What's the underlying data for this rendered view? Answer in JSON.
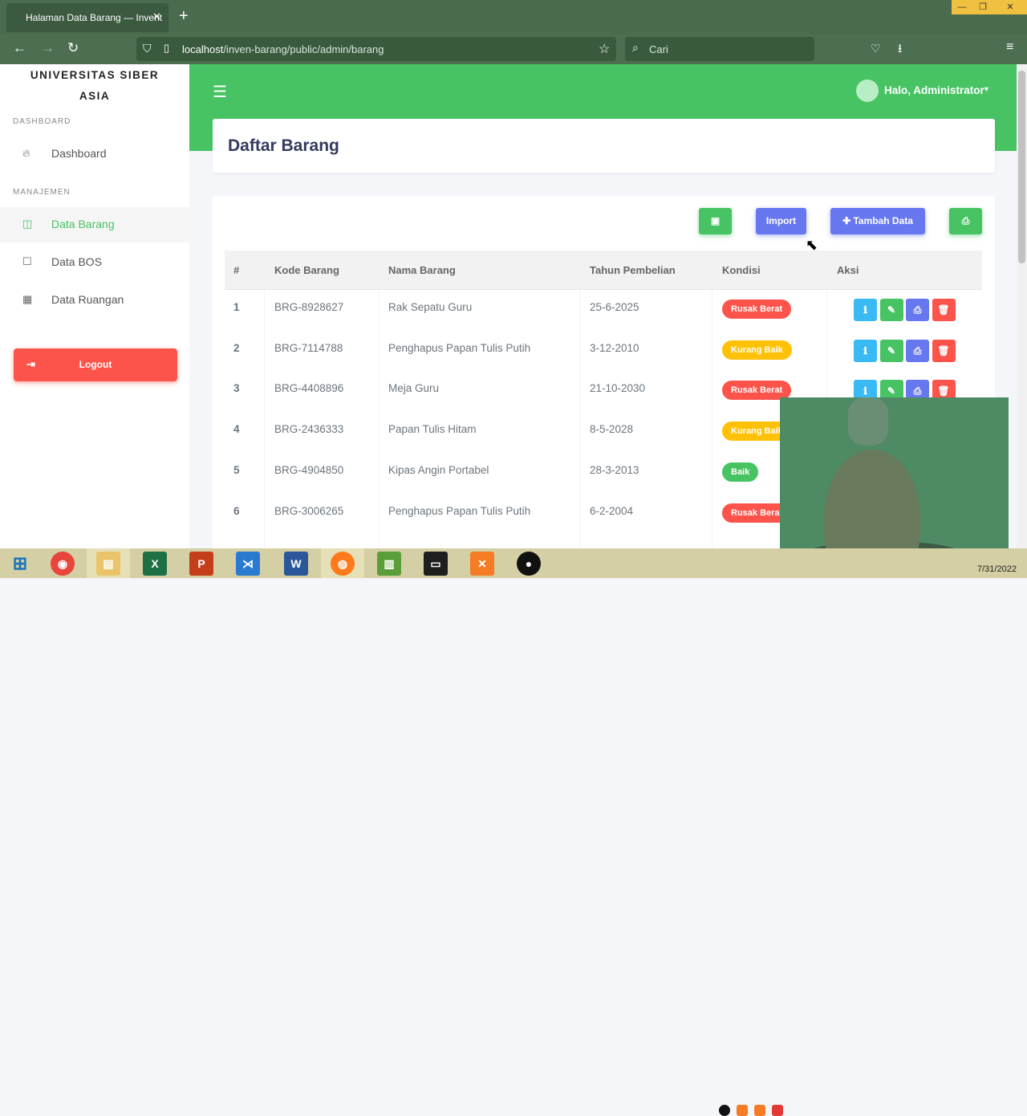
{
  "browser": {
    "tab_title": "Halaman Data Barang — Invent",
    "tab_close": "✕",
    "new_tab": "+",
    "url_host": "localhost",
    "url_path": "/inven-barang/public/admin/barang",
    "search_placeholder": "Cari"
  },
  "sidebar": {
    "brand_line1": "UNIVERSITAS SIBER",
    "brand_line2": "ASIA",
    "section_dashboard": "DASHBOARD",
    "section_manajemen": "MANAJEMEN",
    "items": [
      {
        "label": "Dashboard",
        "icon": "fire-icon"
      },
      {
        "label": "Data Barang",
        "icon": "columns-icon",
        "active": true
      },
      {
        "label": "Data BOS",
        "icon": "square-icon"
      },
      {
        "label": "Data Ruangan",
        "icon": "grid-icon"
      }
    ],
    "logout_label": "Logout"
  },
  "header": {
    "user_greeting": "Halo, Administrator"
  },
  "page": {
    "title": "Daftar Barang",
    "buttons": {
      "excel_icon": "excel-icon",
      "import_label": "Import",
      "tambah_label": "Tambah Data",
      "print_icon": "print-icon"
    },
    "table": {
      "headers": [
        "#",
        "Kode Barang",
        "Nama Barang",
        "Tahun Pembelian",
        "Kondisi",
        "Aksi"
      ],
      "rows": [
        {
          "no": "1",
          "kode": "BRG-8928627",
          "nama": "Rak Sepatu Guru",
          "tahun": "25-6-2025",
          "kondisi": "Rusak Berat"
        },
        {
          "no": "2",
          "kode": "BRG-7114788",
          "nama": "Penghapus Papan Tulis Putih",
          "tahun": "3-12-2010",
          "kondisi": "Kurang Baik"
        },
        {
          "no": "3",
          "kode": "BRG-4408896",
          "nama": "Meja Guru",
          "tahun": "21-10-2030",
          "kondisi": "Rusak Berat"
        },
        {
          "no": "4",
          "kode": "BRG-2436333",
          "nama": "Papan Tulis Hitam",
          "tahun": "8-5-2028",
          "kondisi": "Kurang Baik"
        },
        {
          "no": "5",
          "kode": "BRG-4904850",
          "nama": "Kipas Angin Portabel",
          "tahun": "28-3-2013",
          "kondisi": "Baik"
        },
        {
          "no": "6",
          "kode": "BRG-3006265",
          "nama": "Penghapus Papan Tulis Putih",
          "tahun": "6-2-2004",
          "kondisi": "Rusak Berat"
        }
      ]
    }
  },
  "colors": {
    "primary_green": "#47c363",
    "primary_blue": "#6777ef",
    "danger": "#fc544b",
    "warning": "#ffc107",
    "info": "#3abaf4"
  },
  "taskbar": {
    "clock": "7/31/2022"
  }
}
